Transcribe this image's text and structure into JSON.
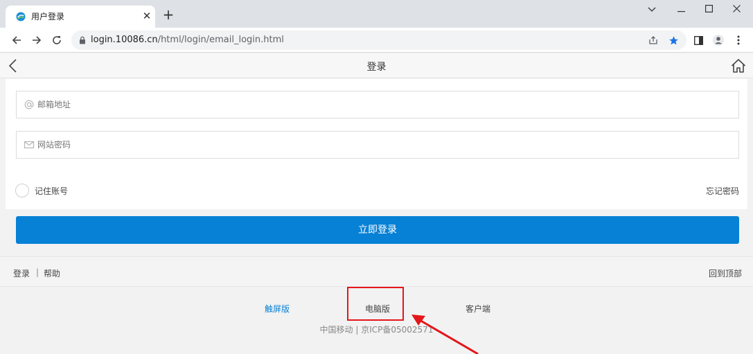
{
  "browser": {
    "tab": {
      "title": "用户登录",
      "favicon": "china-mobile-logo-icon"
    },
    "address": {
      "host": "login.10086.cn",
      "path": "/html/login/email_login.html"
    },
    "colors": {
      "tabbar": "#dee1e6",
      "bookmark_star": "#1a73e8"
    }
  },
  "page": {
    "title": "登录",
    "email_field": {
      "placeholder": "邮箱地址",
      "icon": "at-sign-icon"
    },
    "password_field": {
      "placeholder": "网站密码",
      "icon": "envelope-icon"
    },
    "remember_label": "记住账号",
    "forgot_label": "忘记密码",
    "login_button": "立即登录",
    "footer_links": {
      "login": "登录",
      "separator": "|",
      "help": "帮助",
      "back_to_top": "回到顶部"
    },
    "versions": {
      "touch": "触屏版",
      "pc": "电脑版",
      "client": "客户端"
    },
    "copyright": "中国移动 | 京ICP备05002571",
    "colors": {
      "primary": "#0681d6",
      "touch_link": "#0681d6",
      "annotation": "#e4161a"
    }
  }
}
